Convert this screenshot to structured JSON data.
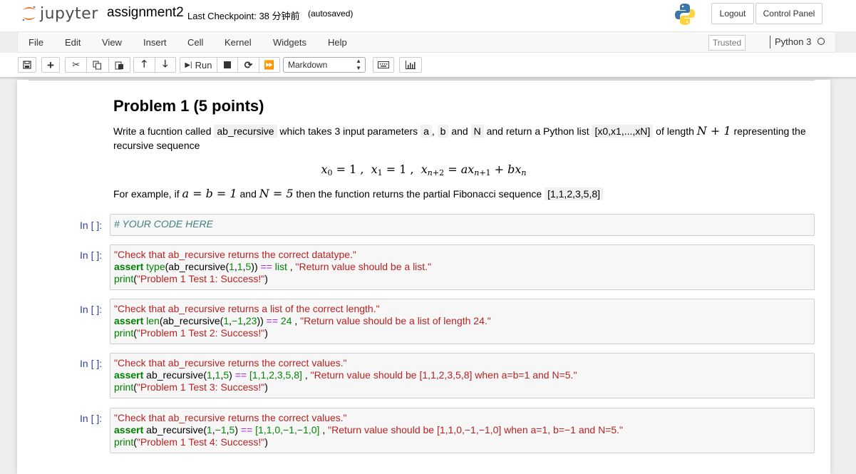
{
  "header": {
    "logo_text": "jupyter",
    "notebook_name": "assignment2",
    "checkpoint": "Last Checkpoint: 38 分钟前",
    "autosaved": "(autosaved)",
    "logout": "Logout",
    "control_panel": "Control Panel"
  },
  "menu": {
    "items": [
      "File",
      "Edit",
      "View",
      "Insert",
      "Cell",
      "Kernel",
      "Widgets",
      "Help"
    ],
    "trusted": "Trusted",
    "kernel_name": "Python 3"
  },
  "toolbar": {
    "run_label": "Run",
    "cell_type": "Markdown"
  },
  "markdown": {
    "title": "Problem 1 (5 points)",
    "p1_a": "Write a fucntion called ",
    "p1_code1": "ab_recursive",
    "p1_b": " which takes 3 input parameters ",
    "p1_code2": "a",
    "p1_c": ", ",
    "p1_code3": "b",
    "p1_d": " and ",
    "p1_code4": "N",
    "p1_e": " and return a Python list ",
    "p1_code5": "[x0,x1,...,xN]",
    "p1_f": " of length ",
    "p1_math": "N + 1",
    "p1_g": " representing the recursive sequence",
    "p2_a": "For example, if ",
    "p2_math1": "a = b = 1",
    "p2_b": " and ",
    "p2_math2": "N = 5",
    "p2_c": " then the function returns the partial Fibonacci sequence ",
    "p2_code": "[1,1,2,3,5,8]"
  },
  "cells": [
    {
      "prompt": "In [ ]:",
      "comment": "# YOUR CODE HERE"
    },
    {
      "prompt": "In [ ]:",
      "docstring": "\"Check that ab_recursive returns the correct datatype.\"",
      "assert_kw": "assert",
      "fn": "type",
      "call": "(ab_recursive(",
      "args": [
        "1",
        ",",
        "1",
        ",",
        "5"
      ],
      "close": "))",
      "op": "==",
      "expected": "list",
      "sep": ",",
      "msg": "\"Return value should be a list.\"",
      "print_fn": "print",
      "print_msg": "\"Problem 1 Test 1: Success!\""
    },
    {
      "prompt": "In [ ]:",
      "docstring": "\"Check that ab_recursive returns a list of the correct length.\"",
      "assert_kw": "assert",
      "fn": "len",
      "call": "(ab_recursive(",
      "args": [
        "1",
        ",",
        "−1",
        ",",
        "23"
      ],
      "close": "))",
      "op": "==",
      "expected": "24",
      "sep": ",",
      "msg": "\"Return value should be a list of length 24.\"",
      "print_fn": "print",
      "print_msg": "\"Problem 1 Test 2: Success!\""
    },
    {
      "prompt": "In [ ]:",
      "docstring": "\"Check that ab_recursive returns the correct values.\"",
      "assert_kw": "assert",
      "fn": "ab_recursive",
      "args": [
        "1",
        ",",
        "1",
        ",",
        "5"
      ],
      "op": "==",
      "expected": "[1,1,2,3,5,8]",
      "sep": ",",
      "msg": "\"Return value should be [1,1,2,3,5,8] when a=b=1 and N=5.\"",
      "print_fn": "print",
      "print_msg": "\"Problem 1 Test 3: Success!\""
    },
    {
      "prompt": "In [ ]:",
      "docstring": "\"Check that ab_recursive returns the correct values.\"",
      "assert_kw": "assert",
      "fn": "ab_recursive",
      "args": [
        "1",
        ",",
        "−1",
        ",",
        "5"
      ],
      "op": "==",
      "expected": "[1,1,0,−1,−1,0]",
      "sep": ",",
      "msg": "\"Return value should be [1,1,0,−1,−1,0] when a=1, b=−1 and N=5.\"",
      "print_fn": "print",
      "print_msg": "\"Problem 1 Test 4: Success!\""
    }
  ],
  "colors": {
    "accent": "#f37726",
    "prompt": "#303f9f",
    "string": "#ba2121",
    "keyword": "#008000"
  }
}
